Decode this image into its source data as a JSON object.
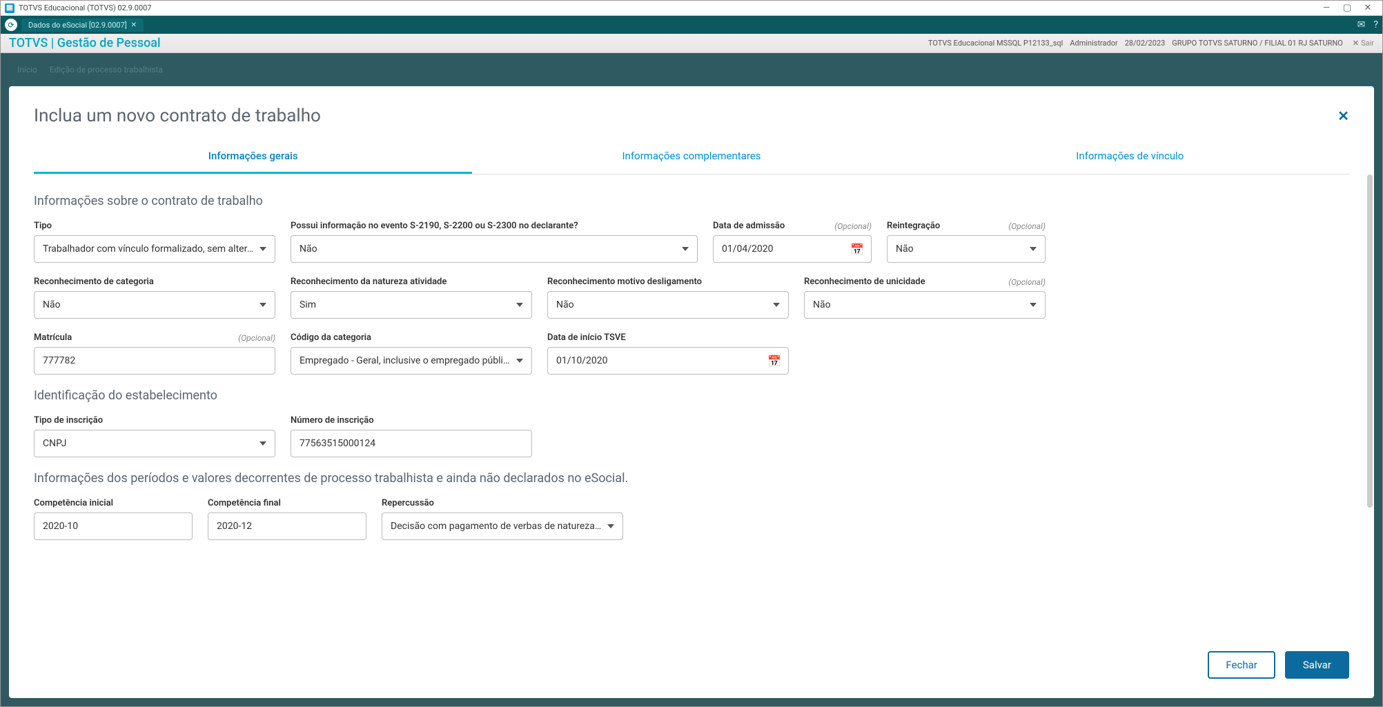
{
  "titlebar": {
    "title": "TOTVS Educacional (TOTVS) 02.9.0007"
  },
  "tabstrip": {
    "tab_label": "Dados do eSocial [02.9.0007]"
  },
  "appbar": {
    "brand": "TOTVS | Gestão de Pessoal",
    "env": "TOTVS Educacional MSSQL P12133_sql",
    "user": "Administrador",
    "date": "28/02/2023",
    "company": "GRUPO TOTVS SATURNO / FILIAL 01 RJ SATURNO",
    "exit": "Sair"
  },
  "breadcrumb": {
    "a": "Início",
    "b": "Edição de processo trabalhista"
  },
  "panel": {
    "title": "Inclua um novo contrato de trabalho"
  },
  "tabs": {
    "a": "Informações gerais",
    "b": "Informações complementares",
    "c": "Informações de vínculo"
  },
  "sec1_title": "Informações sobre o contrato de trabalho",
  "labels": {
    "tipo": "Tipo",
    "possui": "Possui informação no evento S-2190, S-2200 ou S-2300 no declarante?",
    "data_admissao": "Data de admissão",
    "reintegracao": "Reintegração",
    "rec_categoria": "Reconhecimento de categoria",
    "rec_natureza": "Reconhecimento da natureza atividade",
    "rec_motivo": "Reconhecimento motivo desligamento",
    "rec_unicidade": "Reconhecimento de unicidade",
    "matricula": "Matrícula",
    "cod_categoria": "Código da categoria",
    "data_tsve": "Data de início TSVE",
    "tipo_inscricao": "Tipo de inscrição",
    "num_inscricao": "Número de inscrição",
    "comp_inicial": "Competência inicial",
    "comp_final": "Competência final",
    "repercussao": "Repercussão",
    "opcional": "(Opcional)"
  },
  "values": {
    "tipo": "Trabalhador com vínculo formalizado, sem alteração nas",
    "possui": "Não",
    "data_admissao": "01/04/2020",
    "reintegracao": "Não",
    "rec_categoria": "Não",
    "rec_natureza": "Sim",
    "rec_motivo": "Não",
    "rec_unicidade": "Não",
    "matricula": "777782",
    "cod_categoria": "Empregado - Geral, inclusive o empregado público da ad",
    "data_tsve": "01/10/2020",
    "tipo_inscricao": "CNPJ",
    "num_inscricao": "77563515000124",
    "comp_inicial": "2020-10",
    "comp_final": "2020-12",
    "repercussao": "Decisão com pagamento de verbas de natureza remunera"
  },
  "sec2_title": "Identificação do estabelecimento",
  "sec3_title": "Informações dos períodos e valores decorrentes de processo trabalhista e ainda não declarados no eSocial.",
  "buttons": {
    "fechar": "Fechar",
    "salvar": "Salvar"
  }
}
